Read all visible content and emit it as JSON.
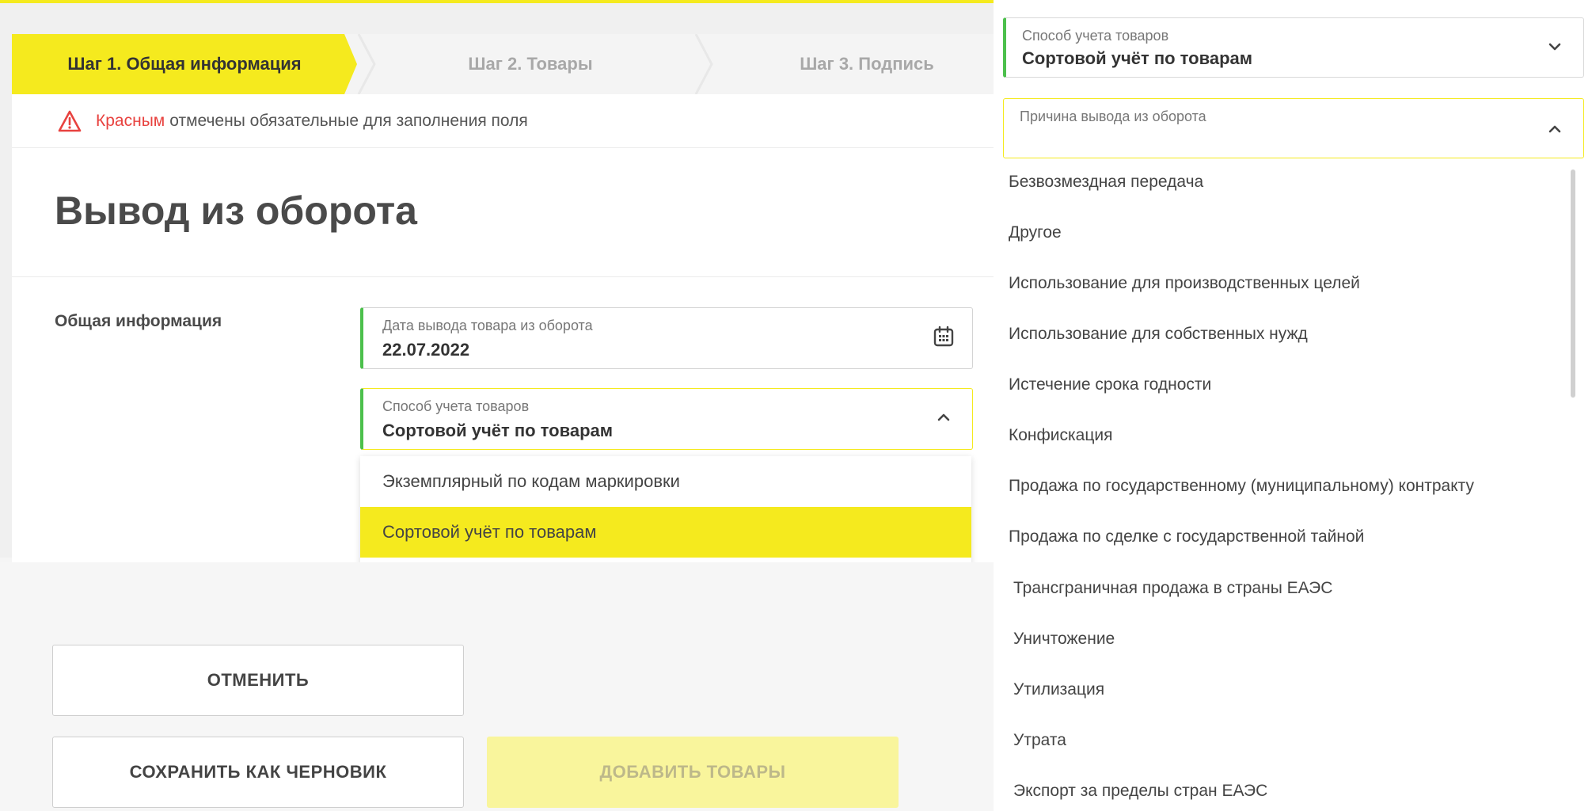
{
  "steps": [
    {
      "label": "Шаг 1. Общая информация"
    },
    {
      "label": "Шаг 2. Товары"
    },
    {
      "label": "Шаг 3. Подпись"
    }
  ],
  "notice": {
    "highlight": "Красным",
    "text": "отмечены обязательные для заполнения поля",
    "icon": "warning-triangle-icon"
  },
  "page_title": "Вывод из оборота",
  "section_title": "Общая информация",
  "fields": {
    "date": {
      "label": "Дата вывода товара из оборота",
      "value": "22.07.2022",
      "icon": "calendar-icon"
    },
    "method": {
      "label": "Способ учета товаров",
      "value": "Сортовой учёт по товарам",
      "icon": "chevron-up-icon"
    }
  },
  "method_options": [
    {
      "label": "Экземплярный по кодам маркировки",
      "selected": false
    },
    {
      "label": "Сортовой учёт по товарам",
      "selected": true
    }
  ],
  "buttons": {
    "cancel": "ОТМЕНИТЬ",
    "draft": "СОХРАНИТЬ КАК ЧЕРНОВИК",
    "add_goods": "ДОБАВИТЬ ТОВАРЫ"
  },
  "right": {
    "method_label": "Способ учета товаров",
    "method_value": "Сортовой учёт по товарам",
    "reason_label": "Причина вывода из оборота",
    "reason_value": "",
    "reasons": [
      "Безвозмездная передача",
      "Другое",
      "Использование для производственных целей",
      "Использование для собственных нужд",
      "Истечение срока годности",
      "Конфискация",
      "Продажа по государственному (муниципальному) контракту",
      "Продажа по сделке с государственной тайной",
      "Трансграничная продажа в страны ЕАЭС",
      "Уничтожение",
      "Утилизация",
      "Утрата",
      "Экспорт за пределы стран ЕАЭС"
    ]
  },
  "colors": {
    "accent": "#f5ea1e",
    "required": "#e8423f",
    "valid": "#4cc04c"
  }
}
